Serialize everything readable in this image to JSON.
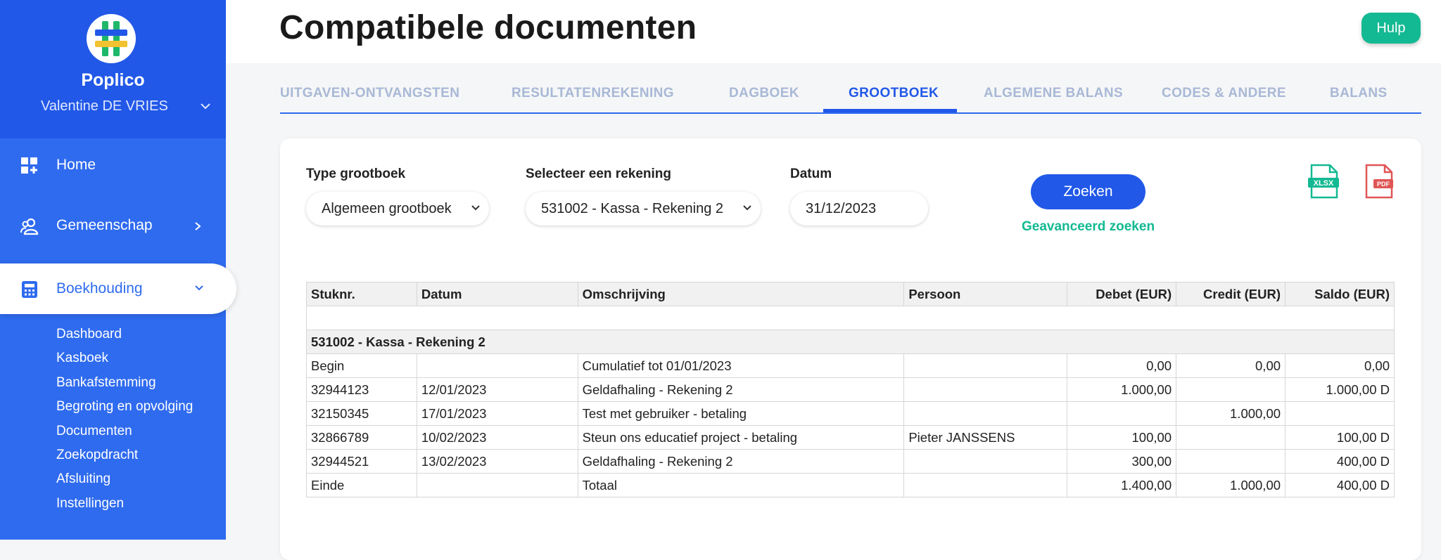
{
  "app": {
    "brand": "Poplico",
    "user": "Valentine DE VRIES",
    "help_label": "Hulp",
    "colors": {
      "primary": "#2158e8",
      "sidebar": "#2f6bef",
      "accent_green": "#13b992"
    }
  },
  "sidebar": {
    "home": "Home",
    "gemeenschap": "Gemeenschap",
    "boekhouding": "Boekhouding",
    "subitems": [
      "Dashboard",
      "Kasboek",
      "Bankafstemming",
      "Begroting en opvolging",
      "Documenten",
      "Zoekopdracht",
      "Afsluiting",
      "Instellingen"
    ]
  },
  "page": {
    "title": "Compatibele documenten"
  },
  "tabs": [
    "UITGAVEN-ONTVANGSTEN",
    "RESULTATENREKENING",
    "DAGBOEK",
    "GROOTBOEK",
    "ALGEMENE BALANS",
    "CODES & ANDERE",
    "BALANS"
  ],
  "active_tab": "GROOTBOEK",
  "filters": {
    "type_label": "Type grootboek",
    "type_value": "Algemeen grootboek",
    "account_label": "Selecteer een rekening",
    "account_value": "531002 - Kassa - Rekening 2",
    "date_label": "Datum",
    "date_value": "31/12/2023",
    "search_label": "Zoeken",
    "advanced_label": "Geavanceerd zoeken",
    "xlsx_icon_label": "XLSX",
    "pdf_icon_label": "PDF"
  },
  "table": {
    "headers": [
      "Stuknr.",
      "Datum",
      "Omschrijving",
      "Persoon",
      "Debet (EUR)",
      "Credit (EUR)",
      "Saldo (EUR)"
    ],
    "group_title": "531002 - Kassa - Rekening 2",
    "rows": [
      [
        "Begin",
        "",
        "Cumulatief tot 01/01/2023",
        "",
        "0,00",
        "0,00",
        "0,00"
      ],
      [
        "32944123",
        "12/01/2023",
        "Geldafhaling - Rekening 2",
        "",
        "1.000,00",
        "",
        "1.000,00 D"
      ],
      [
        "32150345",
        "17/01/2023",
        "Test met gebruiker - betaling",
        "",
        "",
        "1.000,00",
        ""
      ],
      [
        "32866789",
        "10/02/2023",
        "Steun ons educatief project - betaling",
        "Pieter JANSSENS",
        "100,00",
        "",
        "100,00 D"
      ],
      [
        "32944521",
        "13/02/2023",
        "Geldafhaling - Rekening 2",
        "",
        "300,00",
        "",
        "400,00 D"
      ],
      [
        "Einde",
        "",
        "Totaal",
        "",
        "1.400,00",
        "1.000,00",
        "400,00 D"
      ]
    ]
  }
}
